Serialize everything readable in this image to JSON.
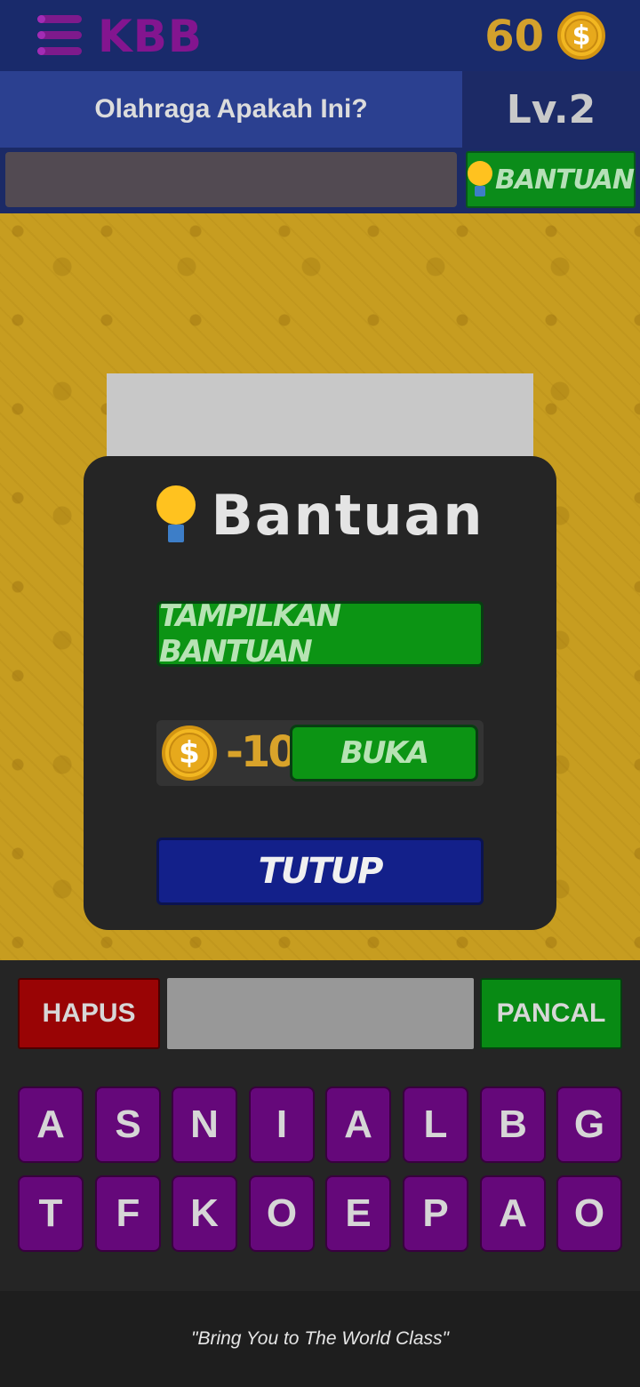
{
  "header": {
    "app_title": "KBB",
    "coins": "60",
    "coin_symbol": "$"
  },
  "question": {
    "text": "Olahraga Apakah Ini?",
    "level": "Lv.2"
  },
  "help_button": {
    "label": "BANTUAN"
  },
  "modal": {
    "title": "Bantuan",
    "show_help_label": "TAMPILKAN BANTUAN",
    "cost": "-10",
    "coin_symbol": "$",
    "open_label": "BUKA",
    "close_label": "TUTUP"
  },
  "controls": {
    "delete_label": "HAPUS",
    "submit_label": "PANCAL"
  },
  "keyboard": {
    "row1": [
      "A",
      "S",
      "N",
      "I",
      "A",
      "L",
      "B",
      "G"
    ],
    "row2": [
      "T",
      "F",
      "K",
      "O",
      "E",
      "P",
      "A",
      "O"
    ]
  },
  "footer": {
    "tagline": "\"Bring You to The World Class\""
  },
  "colors": {
    "accent_purple": "#65087a",
    "green": "#0c9414",
    "blue": "#13208a",
    "red": "#990405",
    "gold": "#c79d20"
  },
  "icons": {
    "menu": "menu-icon",
    "coin": "coin-icon",
    "hint": "lightbulb-icon"
  }
}
